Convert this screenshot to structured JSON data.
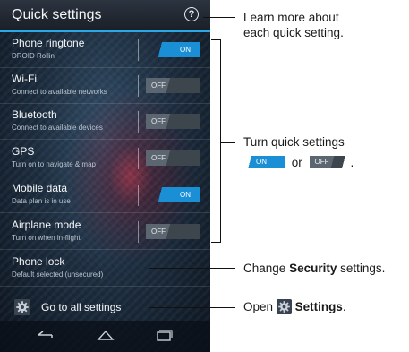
{
  "header": {
    "title": "Quick settings",
    "help_icon": "help-circle-icon"
  },
  "settings": [
    {
      "label": "Phone ringtone",
      "sub": "DROID Rollin",
      "state": "ON"
    },
    {
      "label": "Wi-Fi",
      "sub": "Connect to available networks",
      "state": "OFF"
    },
    {
      "label": "Bluetooth",
      "sub": "Connect to available devices",
      "state": "OFF"
    },
    {
      "label": "GPS",
      "sub": "Turn on to navigate & map",
      "state": "OFF"
    },
    {
      "label": "Mobile data",
      "sub": "Data plan is in use",
      "state": "ON"
    },
    {
      "label": "Airplane mode",
      "sub": "Turn on when in-flight",
      "state": "OFF"
    }
  ],
  "phone_lock": {
    "label": "Phone lock",
    "sub": "Default selected (unsecured)"
  },
  "go_all": {
    "label": "Go to all settings",
    "icon": "gear-icon"
  },
  "navbar": {
    "icons": [
      "back-icon",
      "home-icon",
      "recent-apps-icon"
    ]
  },
  "callouts": {
    "learn": {
      "line1": "Learn more about",
      "line2": "each quick setting."
    },
    "turn": {
      "line1": "Turn quick settings",
      "on": "ON",
      "or": "or",
      "off": "OFF",
      "end": "."
    },
    "security": {
      "prefix": "Change",
      "bold": "Security",
      "suffix": "settings."
    },
    "open": {
      "prefix": "Open",
      "bold": "Settings",
      "suffix": "."
    }
  },
  "colors": {
    "accent": "#1a8fd6",
    "header_line": "#2aa7e6"
  }
}
